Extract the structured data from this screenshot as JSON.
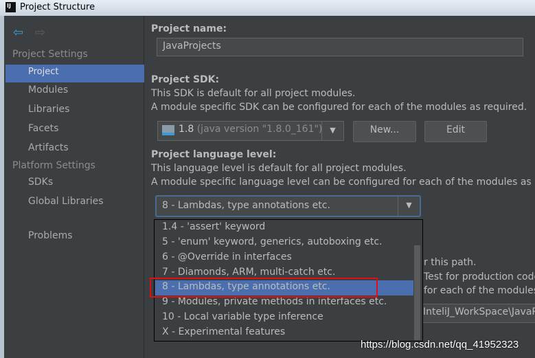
{
  "window": {
    "title": "Project Structure",
    "logo": "IJ"
  },
  "sidebar": {
    "back_icon": "arrow-left-icon",
    "forward_icon": "arrow-right-icon",
    "sections": [
      {
        "title": "Project Settings",
        "items": [
          "Project",
          "Modules",
          "Libraries",
          "Facets",
          "Artifacts"
        ]
      },
      {
        "title": "Platform Settings",
        "items": [
          "SDKs",
          "Global Libraries"
        ]
      }
    ],
    "problems": "Problems",
    "selected": "Project"
  },
  "main": {
    "name_label": "Project name:",
    "name_value": "JavaProjects",
    "sdk_label": "Project SDK:",
    "sdk_desc1": "This SDK is default for all project modules.",
    "sdk_desc2": "A module specific SDK can be configured for each of the modules as required.",
    "sdk_version": "1.8",
    "sdk_detail": "(java version \"1.8.0_161\")",
    "new_button": "New...",
    "edit_button": "Edit",
    "lang_label": "Project language level:",
    "lang_desc1": "This language level is default for all project modules.",
    "lang_desc2": "A module specific language level can be configured for each of the modules as requ",
    "lang_value": "8 - Lambdas, type annotations etc.",
    "hidden_fragments": [
      "r this path.",
      "Test for production code",
      "for each of the modules a",
      "InteliJ_WorkSpace\\JavaP"
    ]
  },
  "dropdown": {
    "options": [
      "1.4 - 'assert' keyword",
      "5 - 'enum' keyword, generics, autoboxing etc.",
      "6 - @Override in interfaces",
      "7 - Diamonds, ARM, multi-catch etc.",
      "8 - Lambdas, type annotations etc.",
      "9 - Modules, private methods in interfaces etc.",
      "10 - Local variable type inference",
      "X - Experimental features"
    ],
    "highlighted_index": 4
  },
  "watermark": "https://blog.csdn.net/qq_41952323",
  "colors": {
    "selection": "#4b6eaf",
    "annotation": "#e01010",
    "background": "#3c3f41"
  }
}
